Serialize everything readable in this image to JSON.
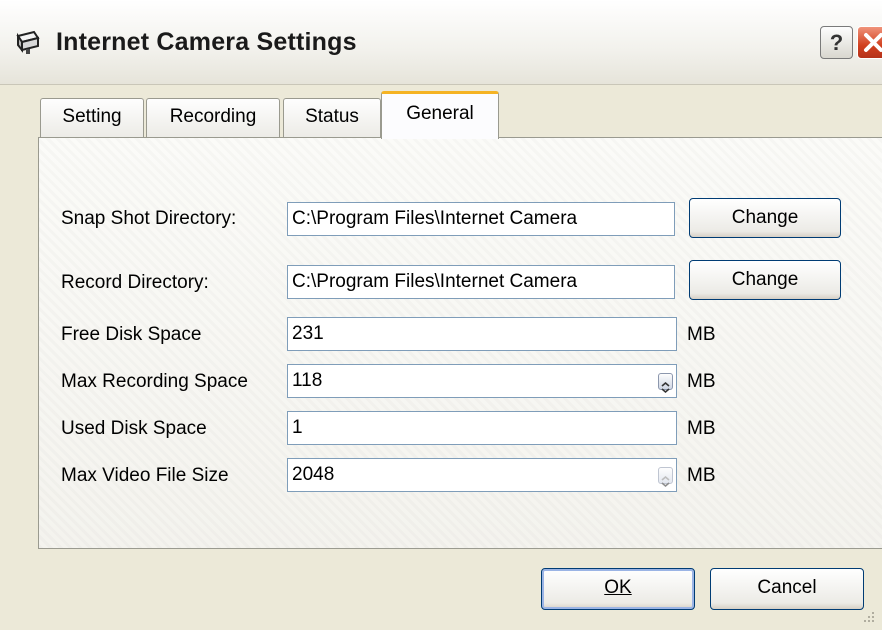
{
  "window": {
    "title": "Internet Camera Settings",
    "title_icon": "camera-icon",
    "help_label": "?",
    "close_icon": "close-icon"
  },
  "tabs": [
    {
      "label": "Setting",
      "active": false
    },
    {
      "label": "Recording",
      "active": false
    },
    {
      "label": "Status",
      "active": false
    },
    {
      "label": "General",
      "active": true
    }
  ],
  "general": {
    "snapshot": {
      "label": "Snap Shot Directory:",
      "value": "C:\\Program Files\\Internet Camera",
      "button": "Change"
    },
    "record": {
      "label": "Record Directory:",
      "value": "C:\\Program Files\\Internet Camera",
      "button": "Change"
    },
    "free_disk": {
      "label": "Free Disk Space",
      "value": "231",
      "unit": "MB"
    },
    "max_recording": {
      "label": "Max Recording Space",
      "value": "118",
      "unit": "MB"
    },
    "used_disk": {
      "label": "Used Disk Space",
      "value": "1",
      "unit": "MB"
    },
    "max_video": {
      "label": "Max Video File Size",
      "value": "2048",
      "unit": "MB"
    }
  },
  "footer": {
    "ok_label": "OK",
    "cancel_label": "Cancel"
  },
  "colors": {
    "tab_active_accent": "#f5b323",
    "close_button": "#d1401f",
    "button_border": "#003c74",
    "field_border": "#7f9db9"
  }
}
